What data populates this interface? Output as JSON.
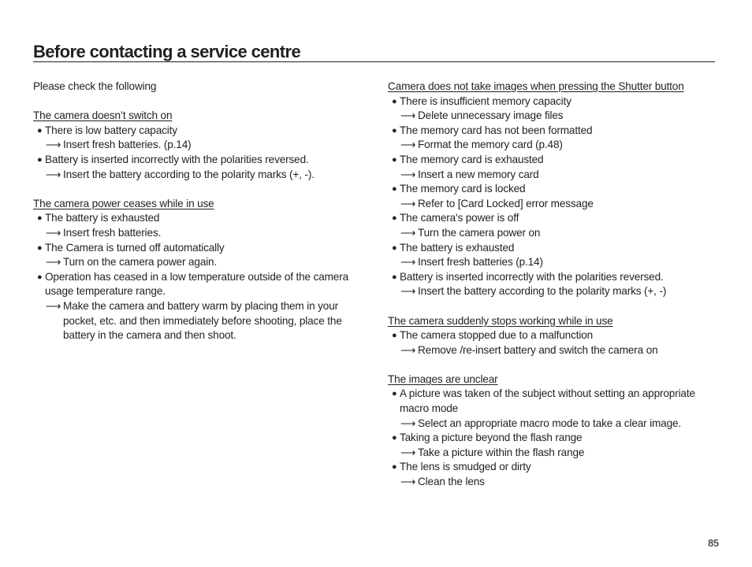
{
  "page": {
    "title": "Before contacting a service centre",
    "intro": "Please check the following",
    "page_number": "85",
    "bullet_glyph": "●",
    "arrow_glyph": "⟶"
  },
  "left_column": {
    "sections": [
      {
        "heading": "The camera doesn’t switch on",
        "items": [
          {
            "cause": "There is low battery capacity",
            "remedy": "Insert fresh batteries. (p.14)"
          },
          {
            "cause": "Battery is inserted incorrectly with the polarities reversed.",
            "remedy": "Insert the battery according to the polarity marks (+, -)."
          }
        ]
      },
      {
        "heading": "The camera power ceases while in use",
        "items": [
          {
            "cause": "The battery is exhausted",
            "remedy": "Insert fresh batteries."
          },
          {
            "cause": "The Camera is turned off automatically",
            "remedy": "Turn on the camera power again."
          },
          {
            "cause": "Operation has ceased in a low temperature outside of the camera usage temperature range.",
            "remedy": "Make the camera and battery warm by placing them in your pocket, etc. and then immediately before shooting, place the battery in the camera and then shoot."
          }
        ]
      }
    ]
  },
  "right_column": {
    "sections": [
      {
        "heading": "Camera does not take images when pressing the Shutter button",
        "items": [
          {
            "cause": "There is insufficient memory capacity",
            "remedy": "Delete unnecessary image files"
          },
          {
            "cause": "The memory card has not been formatted",
            "remedy": "Format the memory card (p.48)"
          },
          {
            "cause": "The memory card is exhausted",
            "remedy": "Insert a new memory card"
          },
          {
            "cause": "The memory card is locked",
            "remedy": "Refer to [Card Locked] error message"
          },
          {
            "cause": "The camera's power is off",
            "remedy": "Turn the camera power on"
          },
          {
            "cause": "The battery is exhausted",
            "remedy": "Insert fresh batteries (p.14)"
          },
          {
            "cause": "Battery is inserted incorrectly with the polarities reversed.",
            "remedy": "Insert the battery according to the polarity marks (+, -)"
          }
        ]
      },
      {
        "heading": "The camera suddenly stops working while in use",
        "items": [
          {
            "cause": "The camera stopped due to a malfunction",
            "remedy": "Remove /re-insert battery and switch the camera on"
          }
        ]
      },
      {
        "heading": "The images are unclear",
        "items": [
          {
            "cause": "A picture was taken of the subject without setting an appropriate macro mode",
            "remedy": "Select an appropriate macro mode to take a clear image."
          },
          {
            "cause": "Taking a picture beyond the flash range",
            "remedy": "Take a picture within the flash range"
          },
          {
            "cause": "The lens is smudged or dirty",
            "remedy": "Clean the lens"
          }
        ]
      }
    ]
  }
}
